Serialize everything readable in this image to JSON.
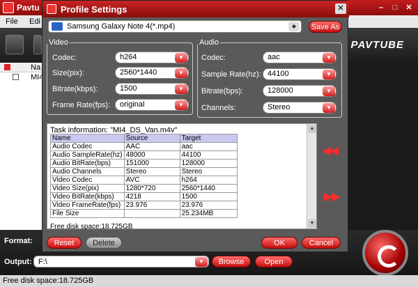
{
  "app": {
    "title": "Pavtu",
    "menu": [
      "File",
      "Edi"
    ],
    "brand": "PAVTUBE",
    "file_header": "Na",
    "file_item": "MI4",
    "format_label": "Format:",
    "output_label": "Output:",
    "output_path": "F:\\",
    "browse_label": "Browse",
    "open_label": "Open",
    "status": "Free disk space:18.725GB"
  },
  "dialog": {
    "title": "Profile Settings",
    "profile": "Samsung Galaxy Note 4(*.mp4)",
    "save_as": "Save As",
    "video": {
      "legend": "Video",
      "codec_label": "Codec:",
      "codec": "h264",
      "size_label": "Size(pix):",
      "size": "2560*1440",
      "bitrate_label": "Bitrate(kbps):",
      "bitrate": "1500",
      "framerate_label": "Frame Rate(fps):",
      "framerate": "original"
    },
    "audio": {
      "legend": "Audio",
      "codec_label": "Codec:",
      "codec": "aac",
      "samplerate_label": "Sample Rate(hz):",
      "samplerate": "44100",
      "bitrate_label": "Bitrate(bps):",
      "bitrate": "128000",
      "channels_label": "Channels:",
      "channels": "Stereo"
    },
    "task_info": "Task information: \"MI4_DS_Van.m4v\"",
    "table": {
      "headers": [
        "Name",
        "Source",
        "Target"
      ],
      "rows": [
        [
          "Audio Codec",
          "AAC",
          "aac"
        ],
        [
          "Audio SampleRate(hz)",
          "48000",
          "44100"
        ],
        [
          "Audio BitRate(bps)",
          "151000",
          "128000"
        ],
        [
          "Audio Channels",
          "Stereo",
          "Stereo"
        ],
        [
          "Video Codec",
          "AVC",
          "h264"
        ],
        [
          "Video Size(pix)",
          "1280*720",
          "2560*1440"
        ],
        [
          "Video BitRate(kbps)",
          "4218",
          "1500"
        ],
        [
          "Video FrameRate(fps)",
          "23.976",
          "23.976"
        ],
        [
          "File Size",
          "",
          "25.234MB"
        ]
      ]
    },
    "free_space": "Free disk space:18.725GB",
    "reset": "Reset",
    "delete": "Delete",
    "ok": "OK",
    "cancel": "Cancel"
  }
}
